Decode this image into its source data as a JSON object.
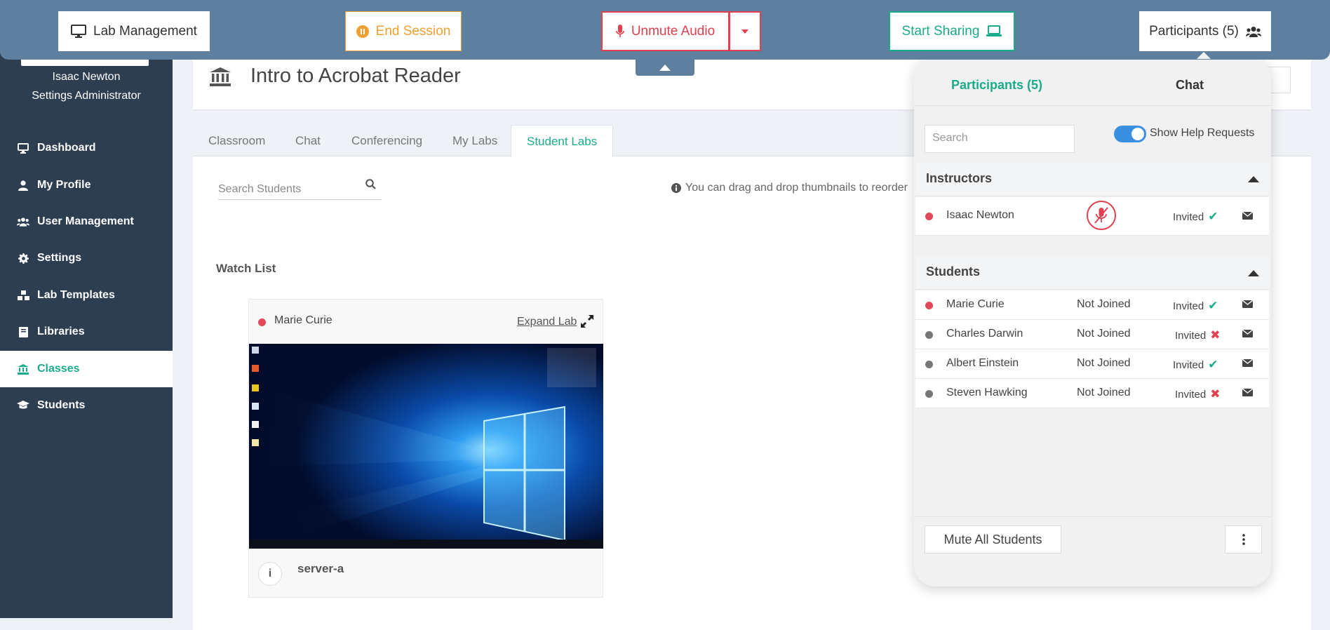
{
  "colors": {
    "toolbar": "#5e7f9e",
    "sidebar": "#2d3e50",
    "accent_green": "#1aab8b",
    "accent_orange": "#f0a030",
    "accent_red": "#e0404f",
    "toggle_blue": "#3b8fe0"
  },
  "toolbar": {
    "lab_management": "Lab Management",
    "end_session": "End Session",
    "unmute_audio": "Unmute Audio",
    "start_sharing": "Start Sharing",
    "participants": "Participants (5)"
  },
  "sidebar": {
    "user_name": "Isaac Newton",
    "user_role": "Settings Administrator",
    "items": [
      {
        "label": "Dashboard",
        "icon": "desktop-icon"
      },
      {
        "label": "My Profile",
        "icon": "user-icon"
      },
      {
        "label": "User Management",
        "icon": "users-icon"
      },
      {
        "label": "Settings",
        "icon": "gear-icon"
      },
      {
        "label": "Lab Templates",
        "icon": "cubes-icon"
      },
      {
        "label": "Libraries",
        "icon": "book-icon"
      },
      {
        "label": "Classes",
        "icon": "bank-icon",
        "active": true
      },
      {
        "label": "Students",
        "icon": "graduation-cap-icon"
      }
    ]
  },
  "class": {
    "title": "Intro to Acrobat Reader"
  },
  "tabs": [
    "Classroom",
    "Chat",
    "Conferencing",
    "My Labs",
    "Student Labs"
  ],
  "active_tab": "Student Labs",
  "student_labs": {
    "search_placeholder": "Search Students",
    "drag_hint": "You can drag and drop thumbnails to reorder",
    "watch_list_label": "Watch List",
    "lab_card": {
      "student": "Marie Curie",
      "expand_label": "Expand Lab",
      "server": "server-a"
    }
  },
  "panel": {
    "tab_participants": "Participants (5)",
    "tab_chat": "Chat",
    "search_placeholder": "Search",
    "toggle_label": "Show Help Requests",
    "toggle_on": true,
    "instructors_heading": "Instructors",
    "students_heading": "Students",
    "instructors": [
      {
        "name": "Isaac Newton",
        "status": "",
        "invited": "Invited",
        "accepted": true,
        "online": true,
        "muted": true
      }
    ],
    "students": [
      {
        "name": "Marie Curie",
        "status": "Not Joined",
        "invited": "Invited",
        "accepted": true,
        "online": true
      },
      {
        "name": "Charles Darwin",
        "status": "Not Joined",
        "invited": "Invited",
        "accepted": false,
        "online": false
      },
      {
        "name": "Albert Einstein",
        "status": "Not Joined",
        "invited": "Invited",
        "accepted": true,
        "online": false
      },
      {
        "name": "Steven Hawking",
        "status": "Not Joined",
        "invited": "Invited",
        "accepted": false,
        "online": false
      }
    ],
    "mute_all_label": "Mute All Students"
  }
}
